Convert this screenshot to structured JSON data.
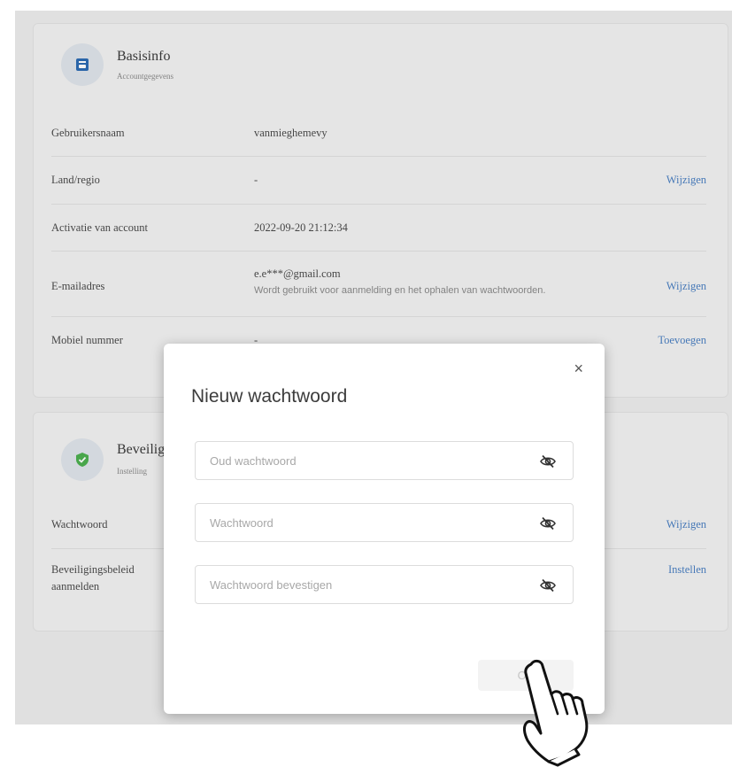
{
  "basic": {
    "title": "Basisinfo",
    "subtitle": "Accountgegevens",
    "rows": [
      {
        "label": "Gebruikersnaam",
        "value": "vanmieghemevy",
        "action": ""
      },
      {
        "label": "Land/regio",
        "value": "-",
        "action": "Wijzigen"
      },
      {
        "label": "Activatie van account",
        "value": "2022-09-20 21:12:34",
        "action": ""
      },
      {
        "label": "E-mailadres",
        "value": "e.e***@gmail.com",
        "hint": "Wordt gebruikt voor aanmelding en het ophalen van wachtwoorden.",
        "action": "Wijzigen"
      },
      {
        "label": "Mobiel nummer",
        "value": "-",
        "action": "Toevoegen"
      }
    ]
  },
  "security": {
    "title": "Beveilig",
    "subtitle": "Instelling",
    "rows": [
      {
        "label": "Wachtwoord",
        "action": "Wijzigen"
      },
      {
        "label": "Beveiligingsbeleid",
        "label2": "aanmelden",
        "action": "Instellen"
      }
    ]
  },
  "modal": {
    "close": "×",
    "title": "Nieuw wachtwoord",
    "fields": [
      {
        "placeholder": "Oud wachtwoord",
        "value": ""
      },
      {
        "placeholder": "Wachtwoord",
        "value": ""
      },
      {
        "placeholder": "Wachtwoord bevestigen",
        "value": ""
      }
    ],
    "ok_label": "OK"
  },
  "icons": {
    "basic": "id-card-icon",
    "security": "shield-check-icon",
    "eye": "eye-off-icon",
    "cursor": "hand-pointer-icon"
  },
  "colors": {
    "link": "#4a7fc1",
    "shield": "#4caf50",
    "card_icon": "#2d6bb3"
  }
}
